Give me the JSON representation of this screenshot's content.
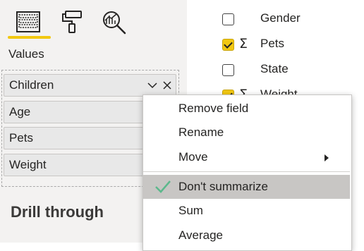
{
  "visualizations": {
    "tabs": [
      {
        "name": "fields-tab",
        "icon": "fields-grid-icon",
        "active": true
      },
      {
        "name": "format-tab",
        "icon": "paint-roller-icon",
        "active": false
      },
      {
        "name": "analytics-tab",
        "icon": "analytics-magnifier-icon",
        "active": false
      }
    ],
    "accent_color": "#f2c811"
  },
  "values_label": "Values",
  "wells": [
    "Children",
    "Age",
    "Pets",
    "Weight"
  ],
  "drill_through_title": "Drill through",
  "fields_list": [
    {
      "name": "Gender",
      "checked": false,
      "sigma": false
    },
    {
      "name": "Pets",
      "checked": true,
      "sigma": true
    },
    {
      "name": "State",
      "checked": false,
      "sigma": false
    },
    {
      "name": "Weight",
      "checked": true,
      "sigma": true
    }
  ],
  "context_menu": {
    "items": [
      {
        "label": "Remove field"
      },
      {
        "label": "Rename"
      },
      {
        "label": "Move",
        "submenu": true
      },
      {
        "label": "Don't summarize",
        "checked": true
      },
      {
        "label": "Sum"
      },
      {
        "label": "Average"
      }
    ],
    "check_color": "#5cb88c"
  }
}
